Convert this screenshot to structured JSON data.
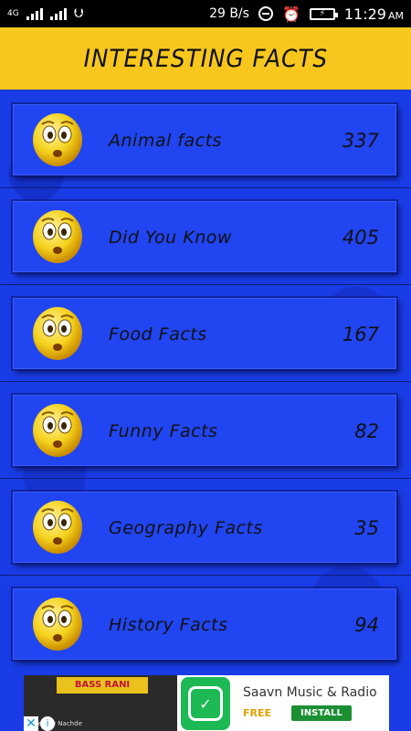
{
  "status_bar": {
    "network_label": "4G",
    "sim2_label": "2",
    "speed": "29 B/s",
    "time": "11:29",
    "ampm": "AM"
  },
  "header": {
    "title": "INTERESTING FACTS",
    "background": "#f7c71e"
  },
  "categories": [
    {
      "label": "Animal facts",
      "count": "337",
      "icon": "worried-face-emoji"
    },
    {
      "label": "Did You Know",
      "count": "405",
      "icon": "worried-face-emoji"
    },
    {
      "label": "Food Facts",
      "count": "167",
      "icon": "worried-face-emoji"
    },
    {
      "label": "Funny Facts",
      "count": "82",
      "icon": "worried-face-emoji"
    },
    {
      "label": "Geography Facts",
      "count": "35",
      "icon": "worried-face-emoji"
    },
    {
      "label": "History Facts",
      "count": "94",
      "icon": "worried-face-emoji"
    }
  ],
  "ad": {
    "image_banner": "BASS RANI",
    "image_caption": "Heels Te Nachde",
    "app_title": "Saavn Music & Radio",
    "price": "FREE",
    "install_label": "INSTALL",
    "icon_color": "#1db954"
  },
  "colors": {
    "list_background": "#1a3ce6",
    "card_background": "#2145f0"
  }
}
